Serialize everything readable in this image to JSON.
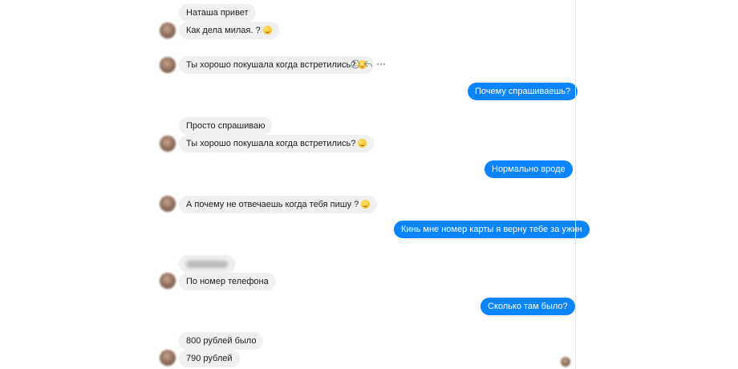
{
  "messages": [
    {
      "text": "Наташа привет"
    },
    {
      "text": "Как дела милая.  ?",
      "emoji": "grinning-face-emoji"
    },
    {
      "text": "Ты хорошо покушала когда встретились?",
      "emoji": "smiling-face-emoji"
    },
    {
      "text": "Почему спрашиваешь?"
    },
    {
      "text": "Просто спрашиваю"
    },
    {
      "text": "Ты хорошо покушала когда встретились?",
      "emoji": "smiling-face-emoji"
    },
    {
      "text": "Нормально вроде"
    },
    {
      "text": "А почему не отвечаешь когда тебя пишу ?",
      "emoji": "smiling-face-emoji"
    },
    {
      "text": "Кинь мне номер карты я верну тебе за ужин"
    },
    {
      "text": "",
      "note_blurred": true
    },
    {
      "text": "По номер телефона"
    },
    {
      "text": "Сколько там было?"
    },
    {
      "text": "800 рублей было"
    },
    {
      "text": "790 рублей"
    }
  ],
  "hover_actions": {
    "react": "smile-icon",
    "reply": "reply-icon",
    "more": "more-icon"
  },
  "colors": {
    "incoming_bubble": "#f0f0f0",
    "outgoing_bubble": "#0a84ff",
    "outgoing_text": "#ffffff"
  }
}
